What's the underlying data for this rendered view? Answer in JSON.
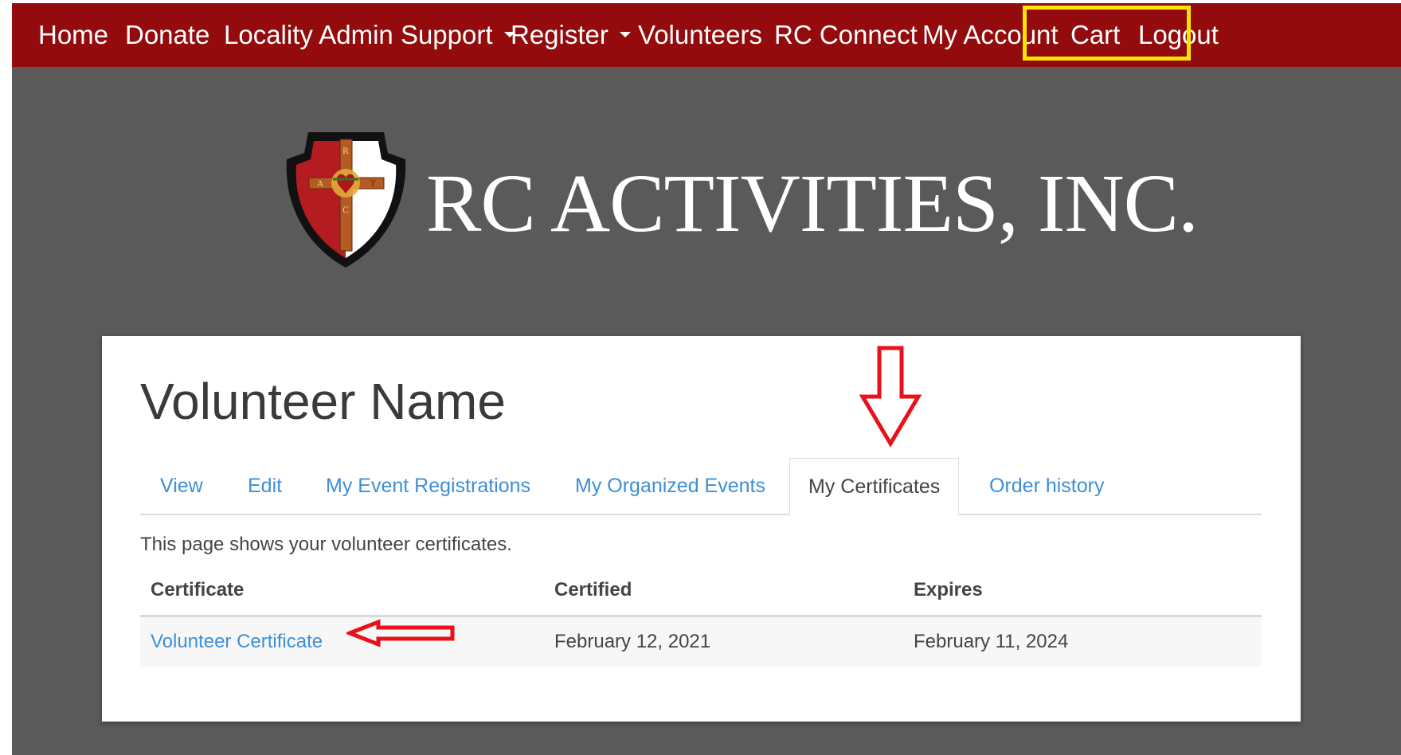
{
  "nav": {
    "items": [
      {
        "label": "Home",
        "dropdown": false
      },
      {
        "label": "Donate",
        "dropdown": false
      },
      {
        "label": "Locality Admin Support",
        "dropdown": true
      },
      {
        "label": "Register",
        "dropdown": true
      },
      {
        "label": "Volunteers",
        "dropdown": false
      },
      {
        "label": "RC Connect",
        "dropdown": false
      },
      {
        "label": "My Account",
        "dropdown": false,
        "highlighted": true
      },
      {
        "label": "Cart",
        "dropdown": false
      },
      {
        "label": "Logout",
        "dropdown": false
      }
    ]
  },
  "brand": {
    "name": "RC ACTIVITIES, INC.",
    "shield_letters": [
      "R",
      "A",
      "C",
      "T"
    ]
  },
  "profile": {
    "title": "Volunteer Name",
    "tabs": [
      {
        "label": "View",
        "active": false
      },
      {
        "label": "Edit",
        "active": false
      },
      {
        "label": "My Event Registrations",
        "active": false
      },
      {
        "label": "My Organized Events",
        "active": false
      },
      {
        "label": "My Certificates",
        "active": true
      },
      {
        "label": "Order history",
        "active": false
      }
    ],
    "intro_text": "This page shows your volunteer certificates.",
    "table": {
      "headers": [
        "Certificate",
        "Certified",
        "Expires"
      ],
      "rows": [
        {
          "certificate": "Volunteer Certificate",
          "certified": "February 12, 2021",
          "expires": "February 11, 2024"
        }
      ]
    }
  },
  "colors": {
    "nav_bg": "#930b0d",
    "page_bg": "#5a5a5a",
    "link": "#3e8fd6",
    "highlight_box": "#ffe400",
    "annotation_arrow": "#e8101a"
  }
}
